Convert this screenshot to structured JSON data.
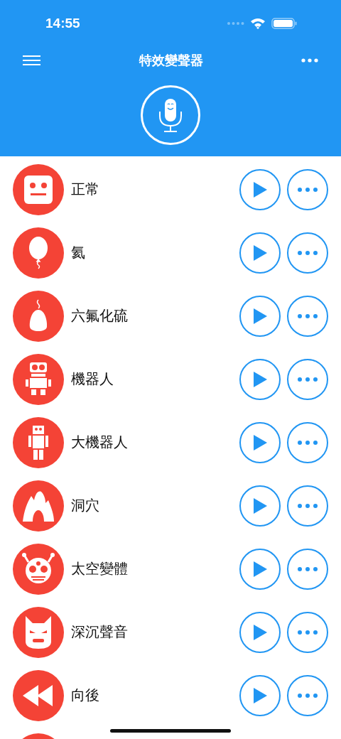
{
  "status_bar": {
    "time": "14:55"
  },
  "header": {
    "title": "特效變聲器"
  },
  "effects": [
    {
      "name": "正常",
      "kind": "face"
    },
    {
      "name": "氦",
      "kind": "balloon"
    },
    {
      "name": "六氟化硫",
      "kind": "weight"
    },
    {
      "name": "機器人",
      "kind": "robot"
    },
    {
      "name": "大機器人",
      "kind": "bigrobot"
    },
    {
      "name": "洞穴",
      "kind": "cave"
    },
    {
      "name": "太空變體",
      "kind": "alien"
    },
    {
      "name": "深沉聲音",
      "kind": "mask"
    },
    {
      "name": "向後",
      "kind": "rewind"
    },
    {
      "kind": "cut"
    }
  ]
}
